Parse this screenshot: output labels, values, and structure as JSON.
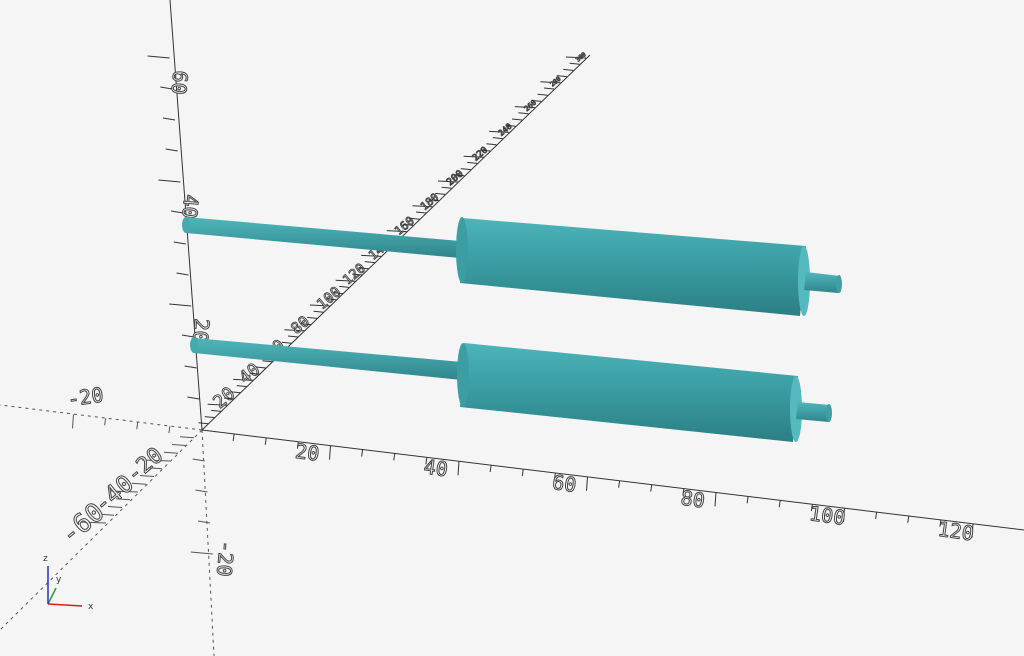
{
  "viewport": {
    "background": "#f5f5f5",
    "model_color": "#3d9ea3",
    "axis_color": "#333333"
  },
  "axes": {
    "x_ticks": [
      "20",
      "40",
      "60",
      "80",
      "100",
      "120"
    ],
    "x_neg_ticks": [
      "-20"
    ],
    "y_ticks": [
      "20",
      "40",
      "60",
      "80",
      "100",
      "120",
      "140",
      "160",
      "180",
      "200",
      "220",
      "240",
      "260",
      "280",
      "300"
    ],
    "y_neg_ticks": [
      "-20",
      "-40",
      "-60"
    ],
    "z_ticks": [
      "20",
      "40",
      "60"
    ],
    "z_neg_ticks": [
      "-20"
    ]
  },
  "gizmo": {
    "x_label": "x",
    "y_label": "y",
    "z_label": "z",
    "x_color": "#d42020",
    "y_color": "#2a9a2a",
    "z_color": "#2030c8"
  }
}
